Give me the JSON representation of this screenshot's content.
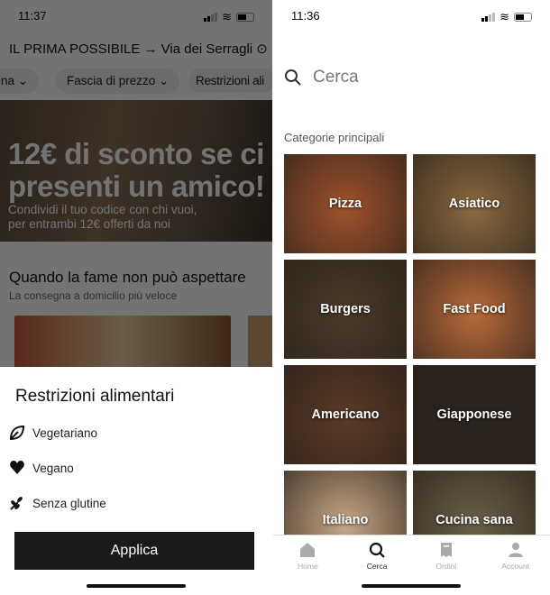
{
  "left": {
    "status": {
      "time": "11:37"
    },
    "address": "IL PRIMA POSSIBILE → Via dei Serragli",
    "filters": [
      "ina",
      "Fascia di prezzo",
      "Restrizioni ali"
    ],
    "banner": {
      "headline_1": "12€ di sconto se ci",
      "headline_2": "presenti un amico!",
      "sub_1": "Condividi il tuo codice con chi vuoi,",
      "sub_2": "per entrambi 12€ offerti da noi"
    },
    "section": {
      "title": "Quando la fame non può aspettare",
      "subtitle": "La consegna a domicilio più veloce"
    },
    "sheet": {
      "title": "Restrizioni alimentari",
      "options": [
        {
          "label": "Vegetariano",
          "icon": "leaf-icon"
        },
        {
          "label": "Vegano",
          "icon": "heart-icon"
        },
        {
          "label": "Senza glutine",
          "icon": "wheat-icon"
        }
      ],
      "apply": "Applica"
    }
  },
  "right": {
    "status": {
      "time": "11:36"
    },
    "search_placeholder": "Cerca",
    "categories_label": "Categorie principali",
    "categories": [
      {
        "label": "Pizza",
        "color": "#a0522d"
      },
      {
        "label": "Asiatico",
        "color": "#8a6a40"
      },
      {
        "label": "Burgers",
        "color": "#4a3a2a"
      },
      {
        "label": "Fast Food",
        "color": "#b86a3a"
      },
      {
        "label": "Americano",
        "color": "#5a3a28"
      },
      {
        "label": "Giapponese",
        "color": "#2a2420"
      },
      {
        "label": "Italiano",
        "color": "#c8a888"
      },
      {
        "label": "Cucina sana",
        "color": "#6a6048"
      }
    ],
    "tabs": [
      {
        "label": "Home",
        "active": false
      },
      {
        "label": "Cerca",
        "active": true
      },
      {
        "label": "Ordini",
        "active": false
      },
      {
        "label": "Account",
        "active": false
      }
    ]
  }
}
